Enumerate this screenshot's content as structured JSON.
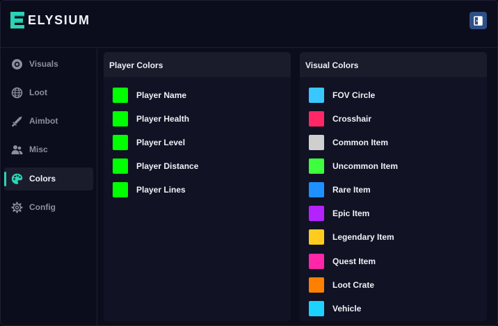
{
  "app": {
    "title": "ELYSIUM"
  },
  "header": {
    "exit_icon": "exit-door-icon",
    "exit_color": "#2e4f88"
  },
  "sidebar": {
    "accent_color": "#2bd4b5",
    "active": "Colors",
    "items": [
      {
        "label": "Visuals",
        "icon": "eye-icon"
      },
      {
        "label": "Loot",
        "icon": "globe-icon"
      },
      {
        "label": "Aimbot",
        "icon": "sword-icon"
      },
      {
        "label": "Misc",
        "icon": "users-icon"
      },
      {
        "label": "Colors",
        "icon": "palette-icon"
      },
      {
        "label": "Config",
        "icon": "gear-icon"
      }
    ]
  },
  "player_colors": {
    "title": "Player Colors",
    "items": [
      {
        "label": "Player Name",
        "color": "#00ff00"
      },
      {
        "label": "Player Health",
        "color": "#00ff00"
      },
      {
        "label": "Player Level",
        "color": "#00ff00"
      },
      {
        "label": "Player Distance",
        "color": "#00ff00"
      },
      {
        "label": "Player Lines",
        "color": "#00ff00"
      }
    ]
  },
  "visual_colors": {
    "title": "Visual Colors",
    "items": [
      {
        "label": "FOV Circle",
        "color": "#38c8ff"
      },
      {
        "label": "Crosshair",
        "color": "#ff2766"
      },
      {
        "label": "Common Item",
        "color": "#cfcfcf"
      },
      {
        "label": "Uncommon Item",
        "color": "#3dff3d"
      },
      {
        "label": "Rare Item",
        "color": "#1e90ff"
      },
      {
        "label": "Epic Item",
        "color": "#b423ff"
      },
      {
        "label": "Legendary Item",
        "color": "#ffcc1e"
      },
      {
        "label": "Quest Item",
        "color": "#ff26a8"
      },
      {
        "label": "Loot Crate",
        "color": "#ff7f00"
      },
      {
        "label": "Vehicle",
        "color": "#1ed2ff"
      }
    ]
  }
}
